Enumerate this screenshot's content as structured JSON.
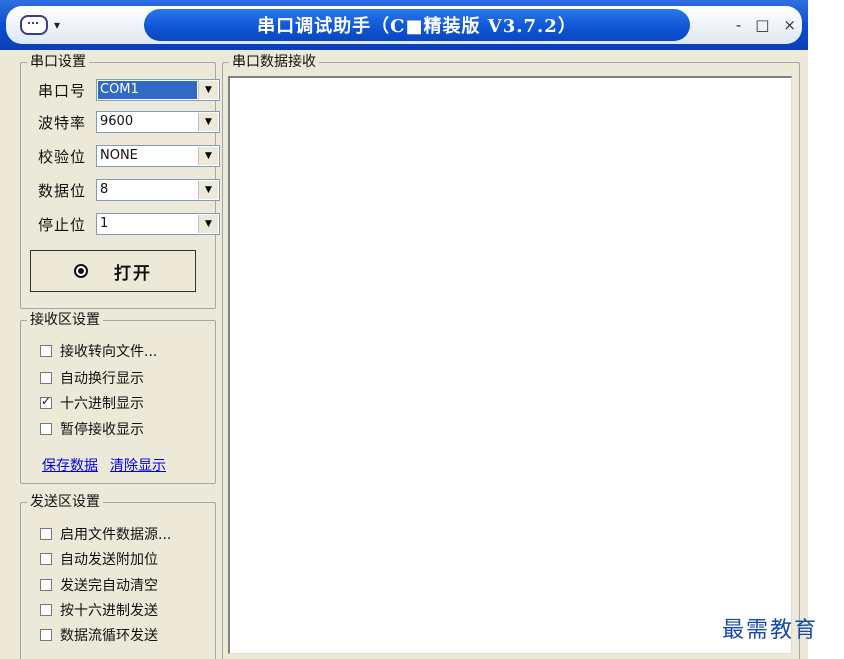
{
  "window": {
    "title": "串口调试助手（C■精装版 V3.7.2）",
    "buttons": {
      "minimize": "-",
      "maximize": "□",
      "close": "×"
    }
  },
  "serial_settings": {
    "legend": "串口设置",
    "port": {
      "label": "串口号",
      "value": "COM1"
    },
    "baud": {
      "label": "波特率",
      "value": "9600"
    },
    "parity": {
      "label": "校验位",
      "value": "NONE"
    },
    "data": {
      "label": "数据位",
      "value": "8"
    },
    "stop": {
      "label": "停止位",
      "value": "1"
    },
    "open_button": "打开"
  },
  "receive_settings": {
    "legend": "接收区设置",
    "options": [
      {
        "label": "接收转向文件...",
        "checked": false
      },
      {
        "label": "自动换行显示",
        "checked": false
      },
      {
        "label": "十六进制显示",
        "checked": true
      },
      {
        "label": "暂停接收显示",
        "checked": false
      }
    ],
    "save_link": "保存数据",
    "clear_link": "清除显示"
  },
  "send_settings": {
    "legend": "发送区设置",
    "options": [
      {
        "label": "启用文件数据源...",
        "checked": false
      },
      {
        "label": "自动发送附加位",
        "checked": false
      },
      {
        "label": "发送完自动清空",
        "checked": false
      },
      {
        "label": "按十六进制发送",
        "checked": false
      },
      {
        "label": "数据流循环发送",
        "checked": false
      }
    ]
  },
  "receive_area": {
    "legend": "串口数据接收"
  },
  "watermark": "最需教育",
  "colors": {
    "titlebar": "#0b4ccf",
    "window_bg": "#ece9d8",
    "selection": "#316ac5",
    "link": "#0000ee"
  }
}
